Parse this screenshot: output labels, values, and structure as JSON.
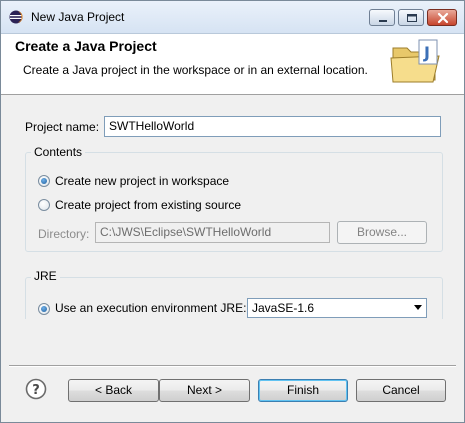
{
  "window": {
    "title": "New Java Project"
  },
  "header": {
    "title": "Create a Java Project",
    "description": "Create a Java project in the workspace or in an external location."
  },
  "project": {
    "name_label": "Project name:",
    "name_value": "SWTHelloWorld"
  },
  "contents": {
    "group_label": "Contents",
    "option_new": "Create new project in workspace",
    "option_existing": "Create project from existing source",
    "directory_label": "Directory:",
    "directory_value": "C:\\JWS\\Eclipse\\SWTHelloWorld",
    "browse_label": "Browse..."
  },
  "jre": {
    "group_label": "JRE",
    "option_env": "Use an execution environment JRE:",
    "env_value": "JavaSE-1.6"
  },
  "footer": {
    "back_label": "< Back",
    "next_label": "Next >",
    "finish_label": "Finish",
    "cancel_label": "Cancel"
  }
}
